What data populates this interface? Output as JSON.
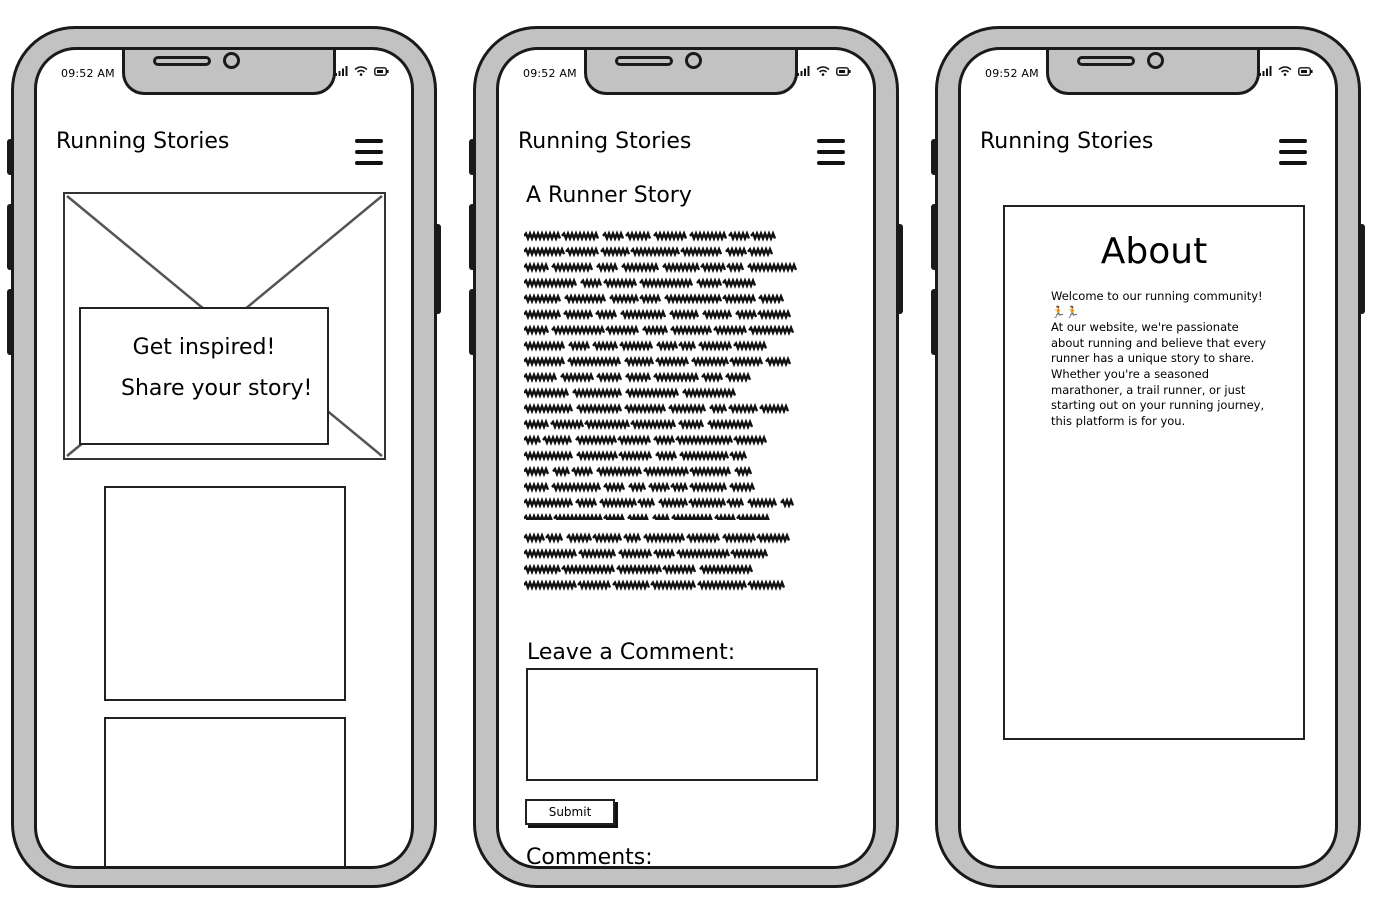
{
  "status_bar": {
    "time": "09:52 AM"
  },
  "app": {
    "title": "Running Stories"
  },
  "phone1": {
    "hero_line1": "Get inspired!",
    "hero_line2": "Share your story!"
  },
  "phone2": {
    "story_title": "A Runner Story",
    "comment_label": "Leave a Comment:",
    "comment_value": "",
    "submit_label": "Submit",
    "comments_label": "Comments:"
  },
  "phone3": {
    "about_title": "About",
    "about_line1": "Welcome to our running community! 🏃🏃",
    "about_line2": "At our website, we're passionate about running and believe that every runner has a unique story to share. Whether you're a seasoned marathoner, a trail runner, or just starting out on your running journey, this platform is for you."
  }
}
